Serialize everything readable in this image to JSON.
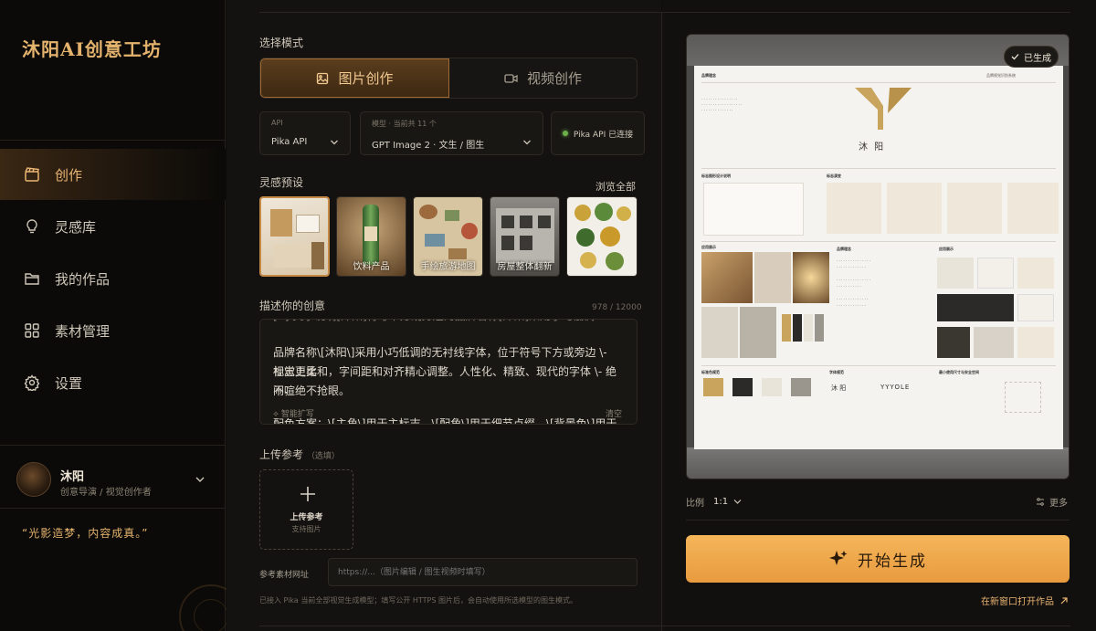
{
  "app": {
    "brand": "沐阳AI创意工坊",
    "slogan": "“光影造梦，内容成真。”"
  },
  "nav": [
    {
      "label": "创作",
      "icon": "clapperboard-icon",
      "active": true
    },
    {
      "label": "灵感库",
      "icon": "lightbulb-icon",
      "active": false
    },
    {
      "label": "我的作品",
      "icon": "folder-icon",
      "active": false
    },
    {
      "label": "素材管理",
      "icon": "grid-icon",
      "active": false
    },
    {
      "label": "设置",
      "icon": "gear-icon",
      "active": false
    }
  ],
  "user": {
    "name": "沐阳",
    "role": "创意导演 / 视觉创作者"
  },
  "mode": {
    "label": "选择模式",
    "image": "图片创作",
    "video": "视频创作",
    "selected": "image"
  },
  "api": {
    "caption": "API",
    "value": "Pika API"
  },
  "model": {
    "caption": "模型 · 当前共 11 个",
    "value": "GPT Image 2 · 文生 / 图生"
  },
  "connection": {
    "text": "Pika API 已连接",
    "status_color": "#6bb04a"
  },
  "presets": {
    "label": "灵感预设",
    "browse": "浏览全部",
    "items": [
      {
        "label": "",
        "selected": true
      },
      {
        "label": "饮料产品",
        "selected": false
      },
      {
        "label": "手绘旅游地图",
        "selected": false
      },
      {
        "label": "房屋整体翻新",
        "selected": false
      },
      {
        "label": "",
        "selected": false
      }
    ]
  },
  "prompt": {
    "label": "描述你的创意",
    "counter": "978 / 12000",
    "line_top": "[X]·文字说明[沐阳]符号下方或旁边的品牌名称[沐阳]采用小巧低调",
    "line1": "品牌名称\\[沐阳\\]采用小巧低调的无衬线字体，位于符号下方或旁边 \\- 视觉上比",
    "line2": "标志更柔和，字间距和对齐精心调整。人性化、精致、现代的字体 \\- 绝不喧",
    "line3": "闹，绝不抢眼。",
    "line4": "配色方案：\\[主角\\]用于主标志，\\[配角\\]用于细节点缀，\\[背景色\\]用于画布",
    "smart": "智能扩写",
    "clear": "清空"
  },
  "upload": {
    "label": "上传参考",
    "optional": "（选填）",
    "title": "上传参考",
    "sub": "支持图片"
  },
  "reference": {
    "label": "参考素材网址",
    "placeholder": "https://...（图片编辑 / 图生视频时填写）"
  },
  "note": "已接入 Pika 当前全部视觉生成模型；填写公开 HTTPS 图片后，会自动使用所选模型的图生模式。",
  "preview": {
    "badge": "已生成",
    "board_title": "沐阳",
    "board_tag": "品牌视觉识别系统",
    "board_sections": [
      "品牌理念",
      "标志图形设计说明",
      "标志演变",
      "色彩规范",
      "应用展示",
      "标准色规范",
      "字体规范",
      "最小使用尺寸与安全空间"
    ],
    "logo_text": "沐 阳",
    "wordmark": "YYYOLE"
  },
  "ratio": {
    "label": "比例",
    "value": "1:1"
  },
  "more": "更多",
  "generate": "开始生成",
  "open_new": "在新窗口打开作品",
  "colors": {
    "accent": "#e4b36e",
    "button": "#f0a94c",
    "bg": "#0e0c0a"
  }
}
